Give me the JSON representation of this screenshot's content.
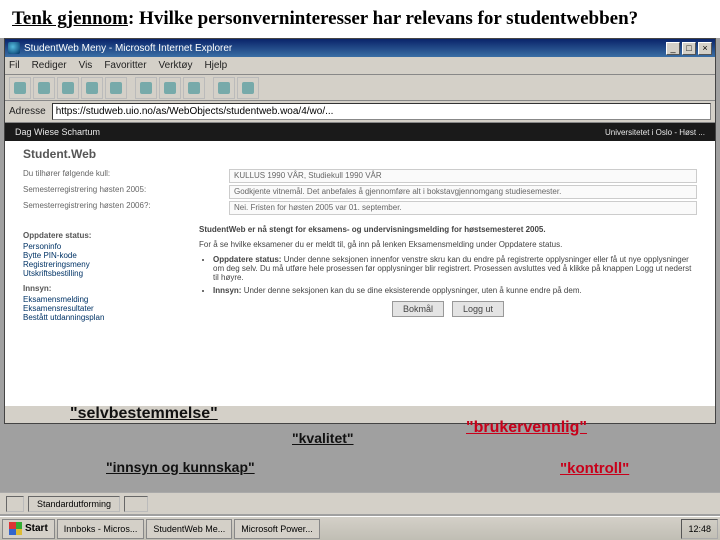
{
  "slide": {
    "title_prefix": "Tenk gjennom",
    "title_rest": ": Hvilke personverninteresser har relevans for studentwebben?"
  },
  "browser": {
    "window_title": "StudentWeb Meny - Microsoft Internet Explorer",
    "menu": [
      "Fil",
      "Rediger",
      "Vis",
      "Favoritter",
      "Verktøy",
      "Hjelp"
    ],
    "address_label": "Adresse",
    "address_value": "https://studweb.uio.no/as/WebObjects/studentweb.woa/4/wo/..."
  },
  "studentweb": {
    "user_name": "Dag Wiese Schartum",
    "uni_label": "Universitetet i Oslo - Høst ...",
    "heading": "Student.Web",
    "rows": [
      {
        "label": "Du tilhører følgende kull:",
        "value": "KULLUS 1990 VÅR, Studiekull 1990 VÅR"
      },
      {
        "label": "Semesterregistrering høsten 2005:",
        "value": "Godkjente vitnemål. Det anbefales å gjennomføre alt i bokstavgjennomgang studiesemester."
      },
      {
        "label": "Semesterregistrering høsten 2006?:",
        "value": "Nei. Fristen for høsten 2005 var 01. september."
      }
    ],
    "left": {
      "oppdatere_h": "Oppdatere status:",
      "oppdatere_items": [
        "Personinfo",
        "Bytte PIN-kode",
        "Registreringsmeny",
        "Utskriftsbestilling"
      ],
      "innsyn_h": "Innsyn:",
      "innsyn_items": [
        "Eksamensmelding",
        "Eksamensresultater",
        "Bestått utdanningsplan"
      ]
    },
    "notice": "StudentWeb er nå stengt for eksamens- og undervisningsmelding for høstsemesteret 2005.",
    "note2": "For å se hvilke eksamener du er meldt til, gå inn på lenken Eksamensmelding under Oppdatere status.",
    "bullets": [
      {
        "h": "Oppdatere status:",
        "t": "Under denne seksjonen innenfor venstre skru kan du endre på registrerte opplysninger eller få ut nye opplysninger om deg selv. Du må utføre hele prosessen før opplysninger blir registrert. Prosessen avsluttes ved å klikke på knappen Logg ut nederst til høyre."
      },
      {
        "h": "Innsyn:",
        "t": "Under denne seksjonen kan du se dine eksisterende opplysninger, uten å kunne endre på dem."
      }
    ],
    "buttons": {
      "bokmal": "Bokmål",
      "loggut": "Logg ut"
    }
  },
  "labels": {
    "selv": "\"selvbestemmelse\"",
    "kvalitet": "\"kvalitet\"",
    "bruker": "\"brukervennlig\"",
    "innsyn": "\"innsyn og kunnskap\"",
    "kontroll": "\"kontroll\""
  },
  "statusbar": {
    "left": "",
    "standard": "Standardutforming"
  },
  "taskbar": {
    "start": "Start",
    "items": [
      "Innboks - Micros...",
      "StudentWeb Me...",
      "Microsoft Power..."
    ],
    "clock": "12:48"
  }
}
